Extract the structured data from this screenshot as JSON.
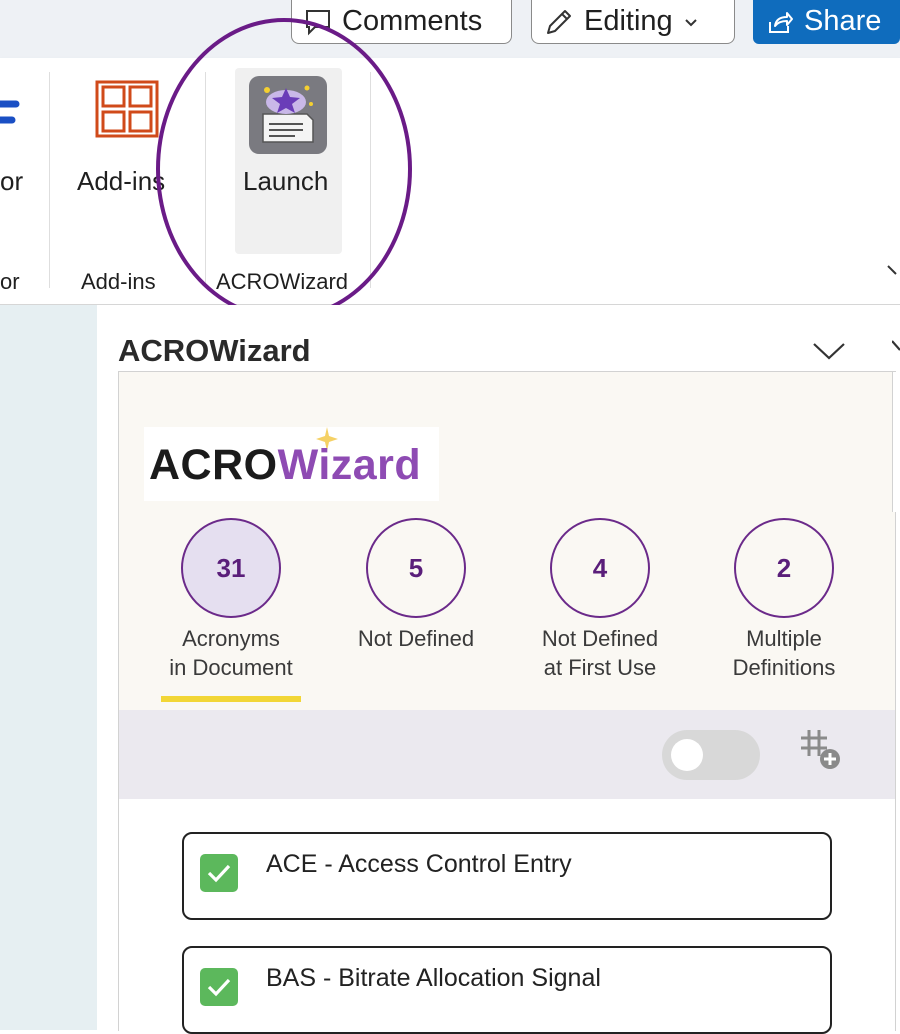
{
  "topbar": {
    "comments_label": "Comments",
    "editing_label": "Editing",
    "share_label": "Share"
  },
  "ribbon": {
    "partial_button_label": "or",
    "partial_group_label": "or",
    "addins_button_label": "Add-ins",
    "addins_group_label": "Add-ins",
    "launch_button_label": "Launch",
    "acrowizard_group_label": "ACROWizard"
  },
  "pane": {
    "title": "ACROWizard",
    "logo": {
      "part1": "ACRO",
      "part2": "Wizard"
    },
    "stats": [
      {
        "count": "31",
        "label_line1": "Acronyms",
        "label_line2": "in Document"
      },
      {
        "count": "5",
        "label_line1": "Not Defined",
        "label_line2": ""
      },
      {
        "count": "4",
        "label_line1": "Not Defined",
        "label_line2": "at First Use"
      },
      {
        "count": "2",
        "label_line1": "Multiple",
        "label_line2": "Definitions"
      }
    ],
    "items": [
      {
        "text": "ACE - Access Control Entry"
      },
      {
        "text": "BAS - Bitrate Allocation Signal"
      }
    ]
  },
  "colors": {
    "accent_purple": "#6b2a8a",
    "share_blue": "#0f6cbd",
    "highlight_yellow": "#f2d636",
    "check_green": "#5cb85c"
  },
  "icons": [
    "comment-icon",
    "pencil-icon",
    "chevron-down-icon",
    "share-icon",
    "addins-grid-icon",
    "acrowizard-launch-icon",
    "collapse-chevron-icon",
    "close-icon",
    "toggle-switch",
    "grid-add-icon",
    "checkbox-checked-icon"
  ]
}
